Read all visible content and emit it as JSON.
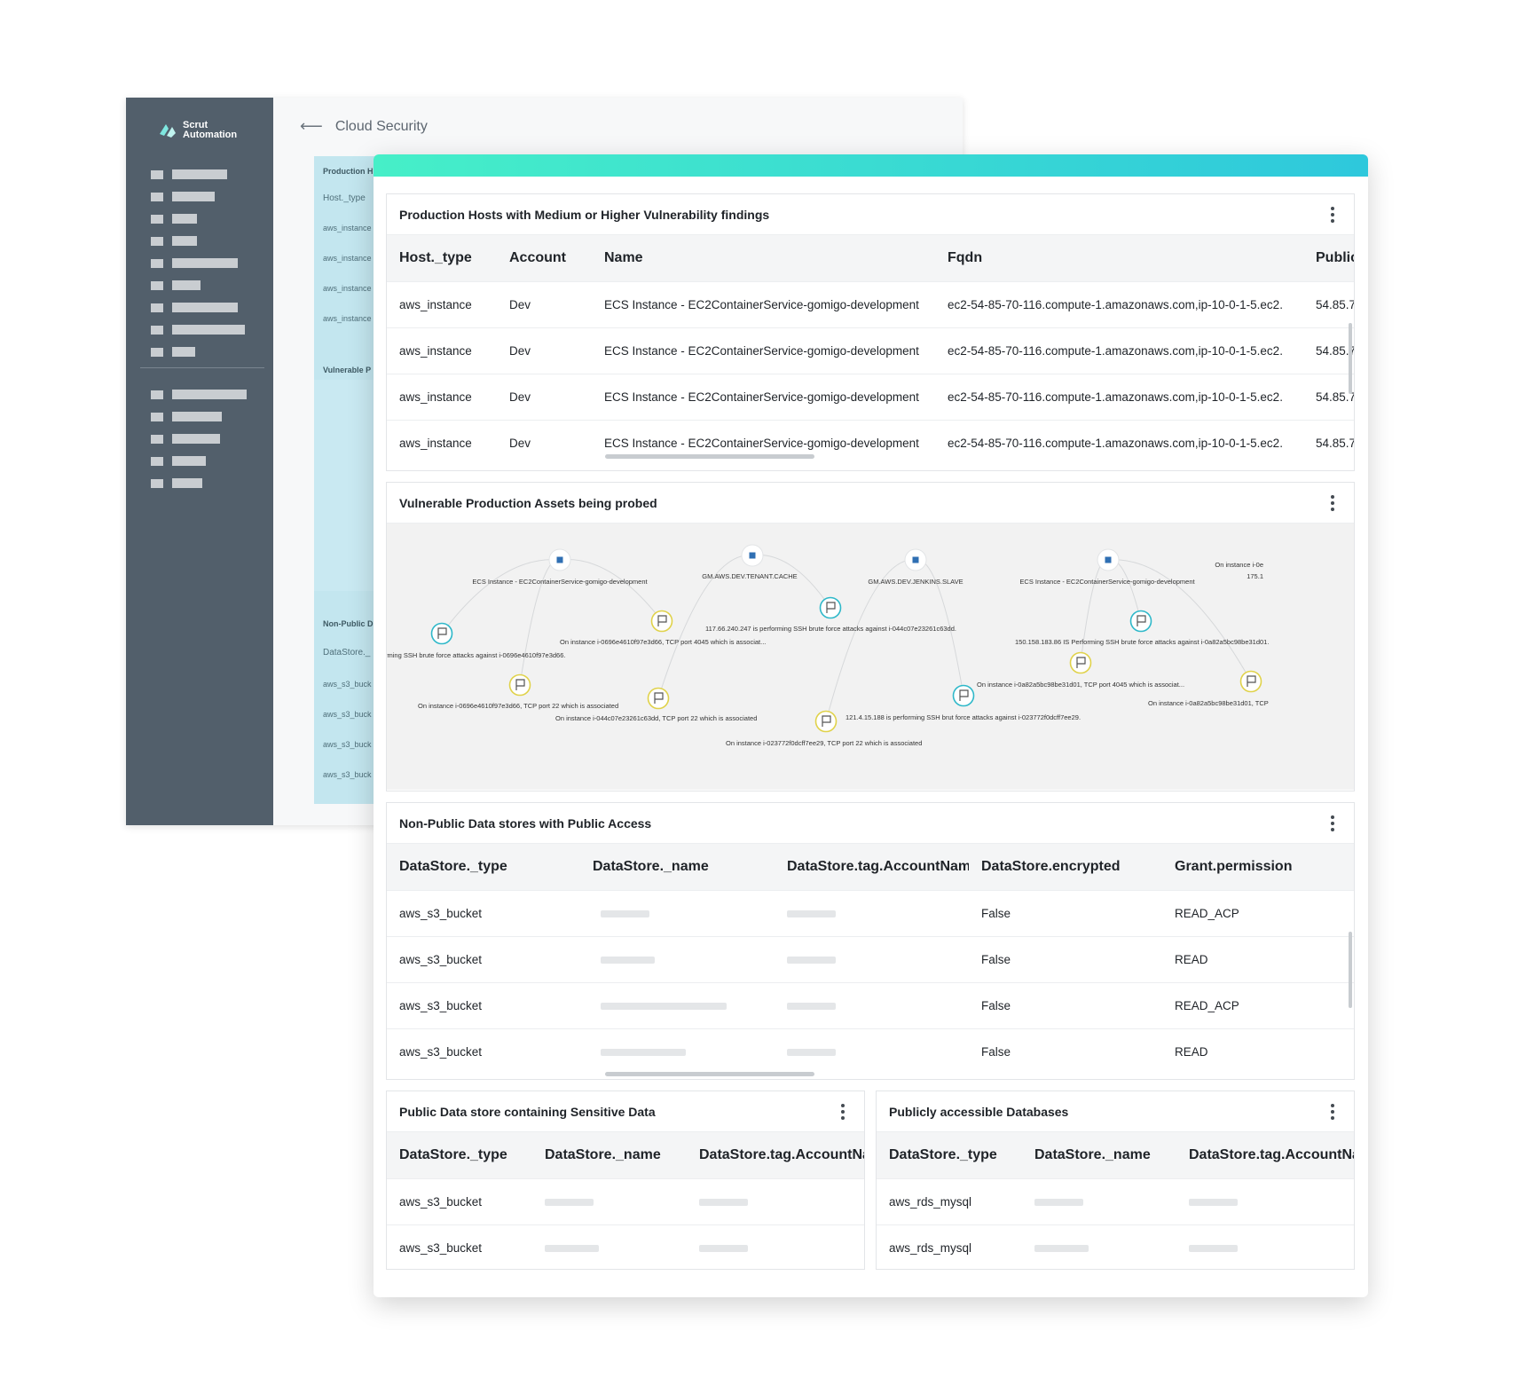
{
  "app": {
    "logo_line1": "Scrut",
    "logo_line2": "Automation",
    "page_title": "Cloud Security",
    "bg_labels": {
      "production": "Production H",
      "host_type": "Host._type",
      "aws_instance": "aws_instance",
      "vulnerable": "Vulnerable P",
      "non_public": "Non-Public D",
      "datastore": "DataStore._",
      "aws_s3": "aws_s3_buck"
    }
  },
  "colors": {
    "sidebar": "#525f6b",
    "gradient_start": "#46efc8",
    "gradient_end": "#2ec8dc",
    "node_blue": "#2f6fb3",
    "flag_teal": "#2eb8c9",
    "flag_yellow": "#e0d24a"
  },
  "panel1": {
    "title": "Production Hosts with Medium or Higher Vulnerability findings",
    "columns": [
      "Host._type",
      "Account",
      "Name",
      "Fqdn",
      "Public"
    ],
    "rows": [
      [
        "aws_instance",
        "Dev",
        "ECS Instance - EC2ContainerService-gomigo-development",
        "ec2-54-85-70-116.compute-1.amazonaws.com,ip-10-0-1-5.ec2.",
        "54.85.7"
      ],
      [
        "aws_instance",
        "Dev",
        "ECS Instance - EC2ContainerService-gomigo-development",
        "ec2-54-85-70-116.compute-1.amazonaws.com,ip-10-0-1-5.ec2.",
        "54.85.7"
      ],
      [
        "aws_instance",
        "Dev",
        "ECS Instance - EC2ContainerService-gomigo-development",
        "ec2-54-85-70-116.compute-1.amazonaws.com,ip-10-0-1-5.ec2.",
        "54.85.7"
      ],
      [
        "aws_instance",
        "Dev",
        "ECS Instance - EC2ContainerService-gomigo-development",
        "ec2-54-85-70-116.compute-1.amazonaws.com,ip-10-0-1-5.ec2.",
        "54.85.7"
      ]
    ]
  },
  "panel2": {
    "title": "Vulnerable Production Assets being probed",
    "graph": {
      "assets": [
        {
          "label": "ECS Instance - EC2ContainerService-gomigo-development"
        },
        {
          "label": "GM.AWS.DEV.TENANT.CACHE"
        },
        {
          "label": "GM.AWS.DEV.JENKINS.SLAVE"
        },
        {
          "label": "ECS Instance - EC2ContainerService-gomigo-development"
        },
        {
          "label": "On instance i-0e"
        }
      ],
      "findings": [
        {
          "label": "rming SSH brute force attacks against i-0696e4610f97e3d66.",
          "kind": "teal"
        },
        {
          "label": "On instance i-0696e4610f97e3d66, TCP port 4045 which is associat...",
          "kind": "yellow"
        },
        {
          "label": "117.66.240.247 is performing SSH brute force attacks against i-044c07e23261c63dd.",
          "kind": "teal"
        },
        {
          "label": "150.158.183.86 IS Performing SSH brute force attacks against i-0a82a5bc98be31d01.",
          "kind": "teal"
        },
        {
          "label": "On instance i-0696e4610f97e3d66, TCP port 22 which is associated",
          "kind": "yellow"
        },
        {
          "label": "On instance i-044c07e23261c63dd, TCP port 22 which is associated",
          "kind": "yellow"
        },
        {
          "label": "On instance i-0a82a5bc98be31d01, TCP port 4045 which is associat...",
          "kind": "yellow"
        },
        {
          "label": "121.4.15.188 is performing SSH brut force attacks against i-023772f0dcff7ee29.",
          "kind": "teal"
        },
        {
          "label": "On instance i-023772f0dcff7ee29, TCP port 22 which is associated",
          "kind": "yellow"
        },
        {
          "label": "On instance i-0a82a5bc98be31d01, TCP",
          "kind": "yellow"
        },
        {
          "label": "175.1",
          "kind": "text"
        }
      ]
    }
  },
  "panel3": {
    "title": "Non-Public Data stores with Public Access",
    "columns": [
      "DataStore._type",
      "DataStore._name",
      "DataStore.tag.AccountName",
      "DataStore.encrypted",
      "Grant.permission"
    ],
    "rows": [
      [
        "aws_s3_bucket",
        "False",
        "READ_ACP"
      ],
      [
        "aws_s3_bucket",
        "False",
        "READ"
      ],
      [
        "aws_s3_bucket",
        "False",
        "READ_ACP"
      ],
      [
        "aws_s3_bucket",
        "False",
        "READ"
      ]
    ]
  },
  "panel4": {
    "title": "Public Data store containing Sensitive Data",
    "columns": [
      "DataStore._type",
      "DataStore._name",
      "DataStore.tag.AccountName"
    ],
    "rows": [
      [
        "aws_s3_bucket"
      ],
      [
        "aws_s3_bucket"
      ]
    ]
  },
  "panel5": {
    "title": "Publicly accessible Databases",
    "columns": [
      "DataStore._type",
      "DataStore._name",
      "DataStore.tag.AccountName"
    ],
    "rows": [
      [
        "aws_rds_mysql"
      ],
      [
        "aws_rds_mysql"
      ]
    ]
  }
}
